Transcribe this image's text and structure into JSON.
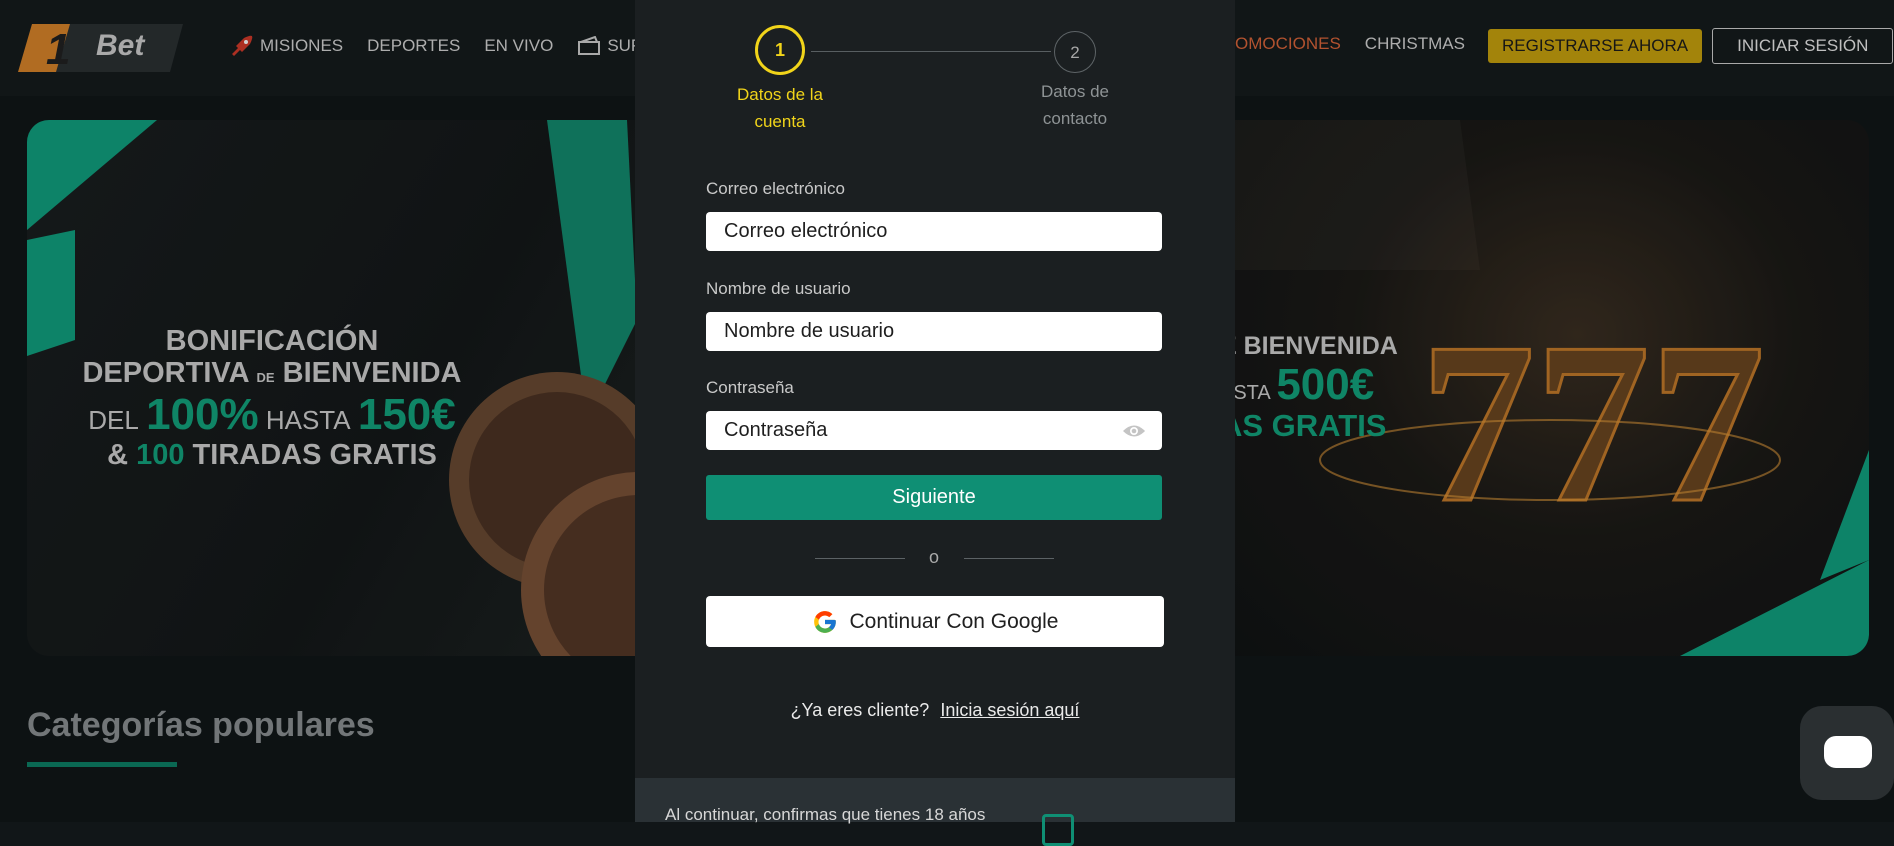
{
  "header": {
    "logo_text": "Bet",
    "logo_number": "1",
    "nav_left": [
      "MISIONES",
      "DEPORTES",
      "EN VIVO",
      "SUPERP"
    ],
    "nav_right": [
      "OMOCIONES",
      "CHRISTMAS"
    ],
    "register_label": "REGISTRARSE AHORA",
    "login_label": "INICIAR SESIÓN"
  },
  "banner_left": {
    "line1": "BONIFICACIÓN",
    "line2a": "DEPORTIVA",
    "line2b": "DE",
    "line2c": "BIENVENIDA",
    "line3a": "DEL",
    "line3b": "100%",
    "line3c": "HASTA",
    "line3d": "150€",
    "line4a": "&",
    "line4b": "100",
    "line4c": "TIRADAS GRATIS"
  },
  "banner_right": {
    "line1": "E BIENVENIDA",
    "line2a": "ASTA",
    "line2b": "500€",
    "line3": "AS GRATIS"
  },
  "categories": {
    "title": "Categorías populares"
  },
  "modal": {
    "step1": {
      "number": "1",
      "label_line1": "Datos de la",
      "label_line2": "cuenta"
    },
    "step2": {
      "number": "2",
      "label_line1": "Datos de",
      "label_line2": "contacto"
    },
    "email": {
      "label": "Correo electrónico",
      "placeholder": "Correo electrónico"
    },
    "username": {
      "label": "Nombre de usuario",
      "placeholder": "Nombre de usuario"
    },
    "password": {
      "label": "Contraseña",
      "placeholder": "Contraseña"
    },
    "next_label": "Siguiente",
    "divider": "o",
    "google_label": "Continuar Con Google",
    "already_text": "¿Ya eres cliente?",
    "login_link": "Inicia sesión aquí",
    "footer_text": "Al continuar, confirmas que tienes 18 años"
  },
  "colors": {
    "accent_green": "#0f8f74",
    "accent_yellow": "#f1d41a",
    "register_gold": "#c7a10e",
    "promo_orange": "#d9653a"
  }
}
